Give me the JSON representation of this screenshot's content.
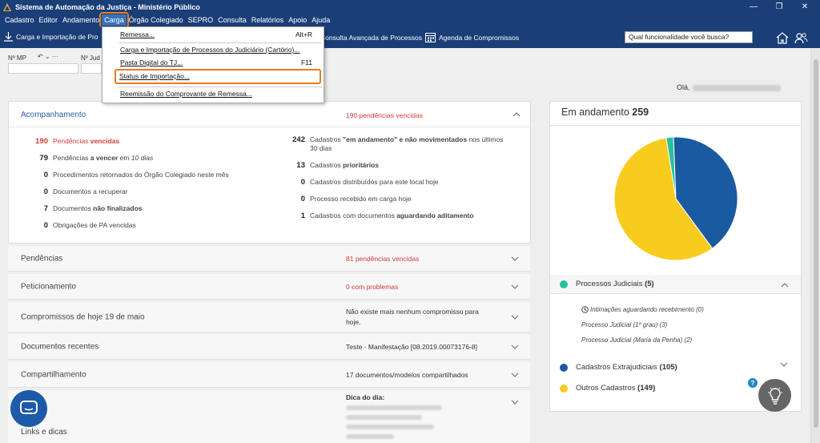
{
  "window": {
    "title": "Sistema de Automação da Justiça - Ministério Público",
    "controls": [
      "—",
      "❐",
      "✕"
    ]
  },
  "menubar": [
    "Cadastro",
    "Editor",
    "Andamento",
    "Carga",
    "Órgão Colegiado",
    "SEPRO",
    "Consulta",
    "Relatórios",
    "Apoio",
    "Ajuda"
  ],
  "toolbar": {
    "item1": "Carga e Importação de Pro",
    "item2": "Consulta Avançada de Processos",
    "item3": "Agenda de Compromissos",
    "search_value": "Qual funcionalidade você busca?"
  },
  "filters": {
    "nmp_label": "Nº MP",
    "njud_label": "Nº Jud"
  },
  "greeting": "Olá,",
  "dropdown": {
    "items": [
      {
        "label": "Remessa...",
        "shortcut": "Alt+R"
      },
      {
        "label": "Carga e Importação de Processos do Judiciário (Cartório)...",
        "shortcut": ""
      },
      {
        "label": "Pasta Digital do TJ...",
        "shortcut": "F11"
      },
      {
        "label": "Status de Importação...",
        "shortcut": ""
      },
      {
        "label": "Reemissão do Comprovante de Remessa...",
        "shortcut": ""
      }
    ]
  },
  "acompanhamento": {
    "title": "Acompanhamento",
    "summary": "190 pendências vencidas",
    "left": [
      {
        "n": "190",
        "pre": "Pendências ",
        "bold": "vencidas",
        "post": ""
      },
      {
        "n": "79",
        "pre": "Pendências ",
        "bold": "a vencer",
        "post": " em ",
        "ital": "10 dias"
      },
      {
        "n": "0",
        "pre": "Procedimentos retornados do Órgão Colegiado neste mês",
        "bold": "",
        "post": ""
      },
      {
        "n": "0",
        "pre": "Documentos a recuperar",
        "bold": "",
        "post": ""
      },
      {
        "n": "7",
        "pre": "Documentos ",
        "bold": "não finalizados",
        "post": ""
      },
      {
        "n": "0",
        "pre": "Obrigações de PA vencidas",
        "bold": "",
        "post": ""
      }
    ],
    "right": [
      {
        "n": "242",
        "pre": "Cadastros ",
        "bold": "\"em andamento\" e não movimentados",
        "post": " nos últimos",
        "line2": "30 dias"
      },
      {
        "n": "13",
        "pre": "Cadastros ",
        "bold": "prioritários",
        "post": ""
      },
      {
        "n": "0",
        "pre": "Cadastros distribuídos para este local hoje",
        "bold": "",
        "post": ""
      },
      {
        "n": "0",
        "pre": "Processo recebido em carga hoje",
        "bold": "",
        "post": ""
      },
      {
        "n": "1",
        "pre": "Cadastros com documentos ",
        "bold": "aguardando aditamento",
        "post": ""
      }
    ]
  },
  "sections": [
    {
      "label": "Pendências",
      "value": "81 pendências vencidas",
      "style": "red"
    },
    {
      "label": "Peticionamento",
      "value": "0 com problemas",
      "style": "red"
    },
    {
      "label": "Compromissos de hoje 19 de maio",
      "value": "Não existe mais nenhum compromisso para",
      "value2": "hoje.",
      "style": "dark"
    },
    {
      "label": "Documentos recentes",
      "value": "Teste - Manifestação [08.2019.00073176-8]",
      "style": "dark"
    },
    {
      "label": "Compartilhamento",
      "value": "17 documentos/modelos compartilhados",
      "style": "dark"
    },
    {
      "label": "Links e dicas",
      "value": "Dica do dia:",
      "style": "dark"
    }
  ],
  "right_panel": {
    "title": "Em andamento",
    "total": "259",
    "groups": [
      {
        "label": "Processos Judiciais",
        "count": "(5)",
        "color": "#2bbf9a"
      },
      {
        "label": "Cadastros Extrajudiciais",
        "count": "(105)",
        "color": "#1a5aa0"
      },
      {
        "label": "Outros Cadastros",
        "count": "(149)",
        "color": "#f8cb1f"
      }
    ],
    "subitems": [
      "Intimações aguardando recebimento (0)",
      "Processo Judicial (1º grau) (3)",
      "Processo Judicial (Maria da Penha) (2)"
    ]
  },
  "chart_data": {
    "type": "pie",
    "categories": [
      "Processos Judiciais",
      "Cadastros Extrajudiciais",
      "Outros Cadastros"
    ],
    "values": [
      5,
      105,
      149
    ],
    "colors": [
      "#2bbf9a",
      "#1a5aa0",
      "#f8cb1f"
    ]
  },
  "help": "?"
}
